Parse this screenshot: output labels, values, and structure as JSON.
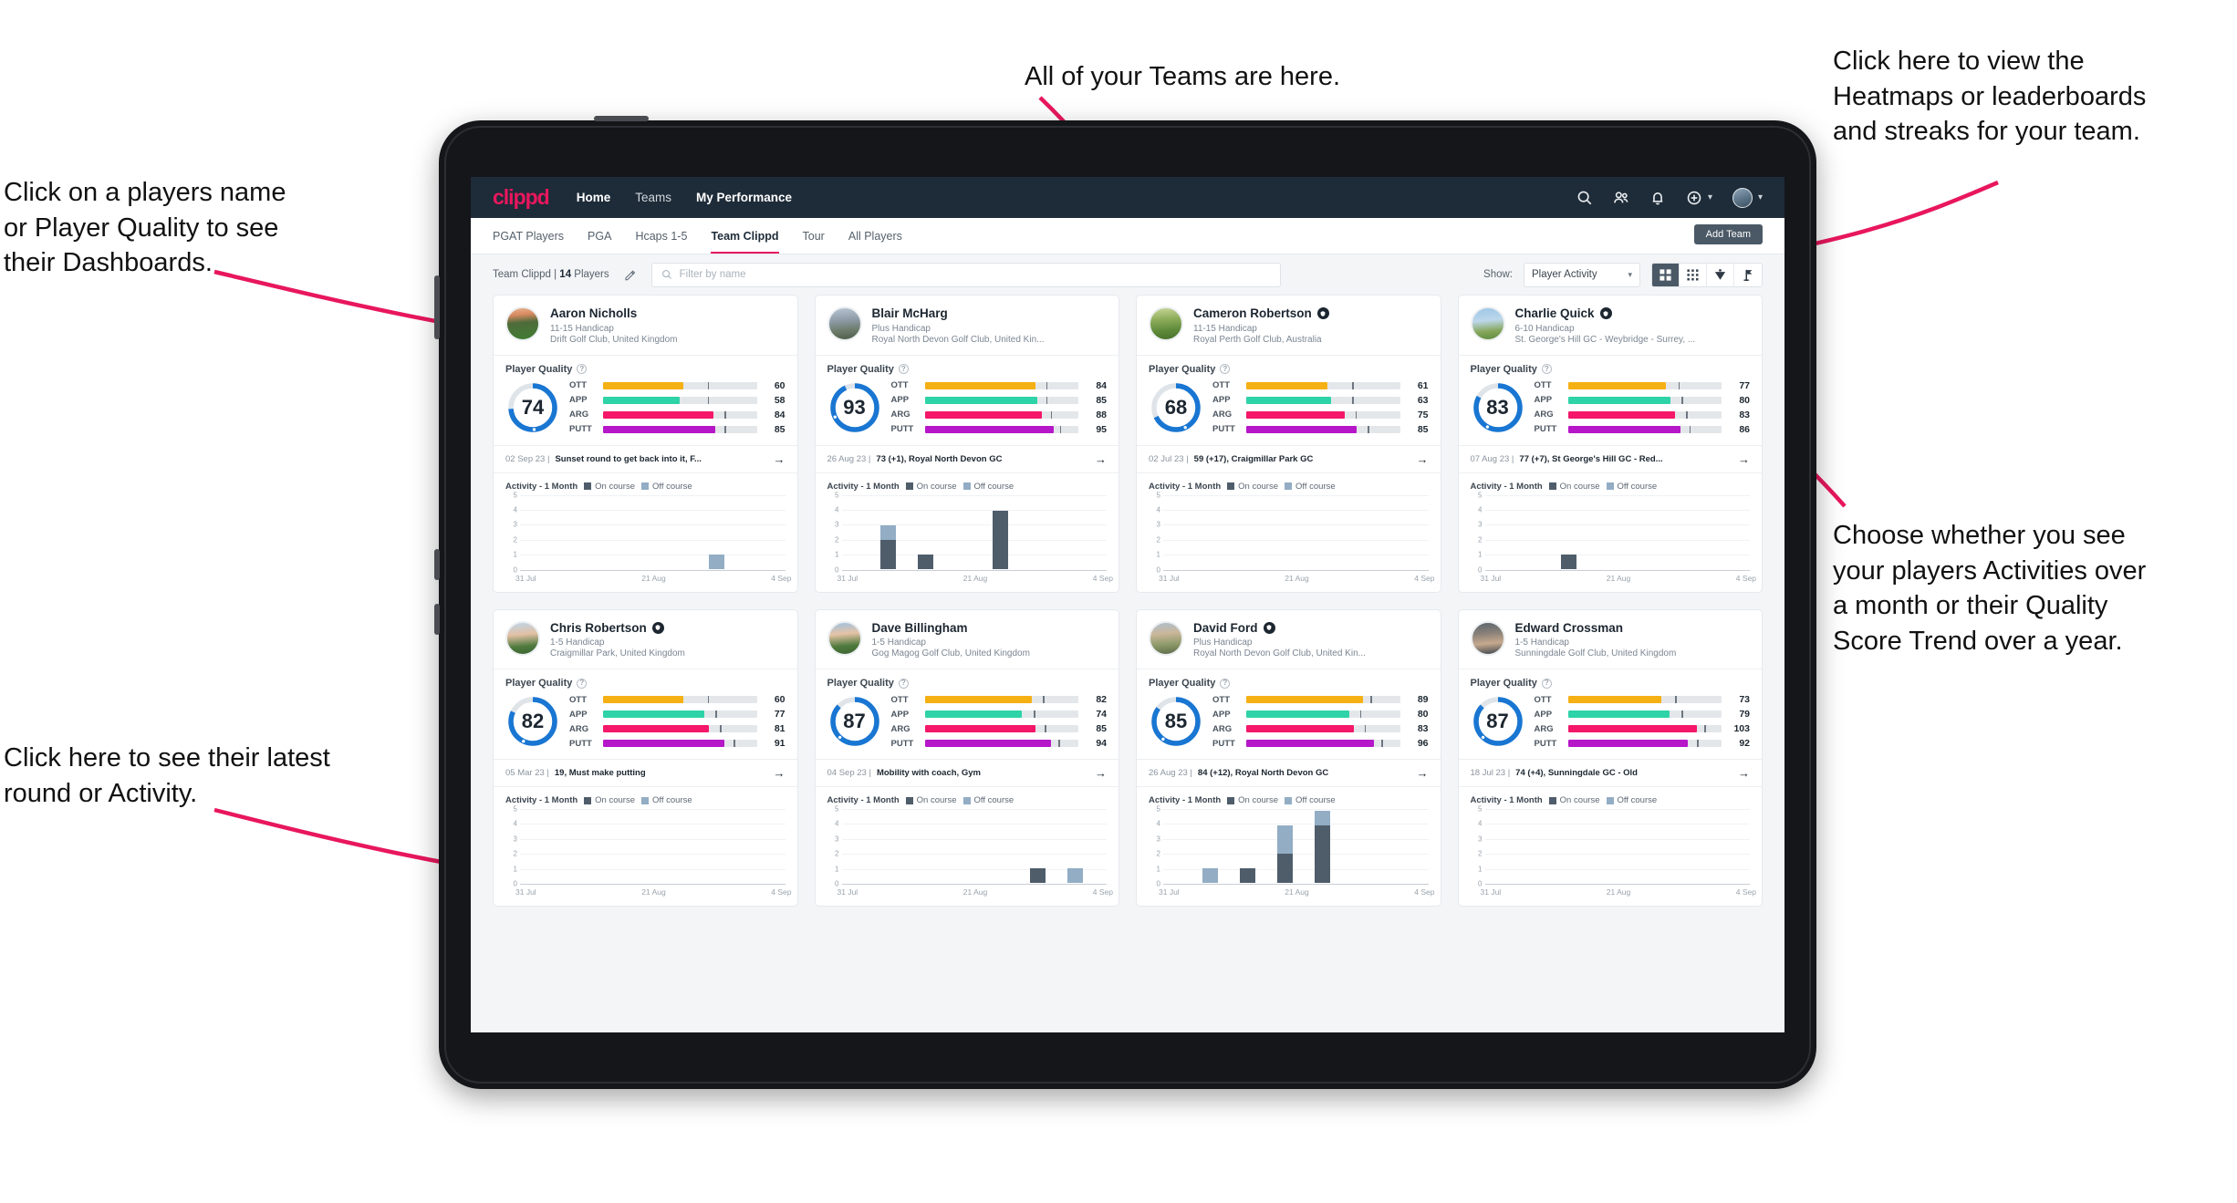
{
  "annotations": [
    {
      "id": "teams",
      "text": "All of your Teams are here."
    },
    {
      "id": "heatmaps",
      "text": "Click here to view the\nHeatmaps or leaderboards\nand streaks for your team."
    },
    {
      "id": "player-name",
      "text": "Click on a players name\nor Player Quality to see\ntheir Dashboards."
    },
    {
      "id": "activity-toggle",
      "text": "Choose whether you see\nyour players Activities over\na month or their Quality\nScore Trend over a year."
    },
    {
      "id": "latest-round",
      "text": "Click here to see their latest\nround or Activity."
    }
  ],
  "app": {
    "brand": "clippd",
    "nav": [
      {
        "label": "Home",
        "active": true
      },
      {
        "label": "Teams",
        "active": false
      },
      {
        "label": "My Performance",
        "active": false
      }
    ],
    "nav_icons": [
      "search-icon",
      "people-icon",
      "bell-icon",
      "plus-circle-icon",
      "avatar"
    ],
    "subtabs": [
      {
        "label": "PGAT Players",
        "active": false
      },
      {
        "label": "PGA",
        "active": false
      },
      {
        "label": "Hcaps 1-5",
        "active": false
      },
      {
        "label": "Team Clippd",
        "active": true
      },
      {
        "label": "Tour",
        "active": false
      },
      {
        "label": "All Players",
        "active": false
      }
    ],
    "add_team_label": "Add Team",
    "filterbar": {
      "team_prefix": "Team Clippd | ",
      "team_count": "14",
      "team_suffix": " Players",
      "edit_icon": "pencil-icon",
      "search_placeholder": "Filter by name",
      "show_label": "Show:",
      "select_value": "Player Activity",
      "view_toggles": [
        {
          "icon": "grid-large-icon",
          "active": true
        },
        {
          "icon": "grid-small-icon",
          "active": false
        },
        {
          "icon": "heatmap-icon",
          "active": false
        },
        {
          "icon": "leaderboard-flag-icon",
          "active": false
        }
      ]
    }
  },
  "labels": {
    "player_quality": "Player Quality",
    "activity": "Activity - 1 Month",
    "legend_on": "On course",
    "legend_off": "Off course",
    "skills": [
      "OTT",
      "APP",
      "ARG",
      "PUTT"
    ]
  },
  "colors": {
    "brand": "#e8175d",
    "navbar": "#1e2b38",
    "ring": "#1976d2",
    "ott": "#f5b014",
    "app": "#2ed3a7",
    "arg": "#f4176a",
    "putt": "#b517c9",
    "on_course": "#4f5d६b",
    "off_course": "#92adc4"
  },
  "chart_data": {
    "type": "bar",
    "title": "Activity - 1 Month",
    "ylabel": "",
    "ylim": [
      0,
      5
    ],
    "yticks": [
      0,
      1,
      2,
      3,
      4,
      5
    ],
    "xticks": [
      "31 Jul",
      "21 Aug",
      "4 Sep"
    ],
    "stacked": true,
    "legend": [
      "On course",
      "Off course"
    ],
    "legend_position": "top",
    "charts": [
      {
        "player": "Aaron Nicholls",
        "bins": [
          {
            "i": 5,
            "on": 0,
            "off": 1
          }
        ]
      },
      {
        "player": "Blair McHarg",
        "bins": [
          {
            "i": 1,
            "on": 2,
            "off": 1
          },
          {
            "i": 2,
            "on": 1,
            "off": 0
          },
          {
            "i": 4,
            "on": 4,
            "off": 0
          }
        ]
      },
      {
        "player": "Cameron Robertson",
        "bins": []
      },
      {
        "player": "Charlie Quick",
        "bins": [
          {
            "i": 2,
            "on": 1,
            "off": 0
          }
        ]
      },
      {
        "player": "Chris Robertson",
        "bins": []
      },
      {
        "player": "Dave Billingham",
        "bins": [
          {
            "i": 5,
            "on": 1,
            "off": 0
          },
          {
            "i": 6,
            "on": 0,
            "off": 1
          }
        ]
      },
      {
        "player": "David Ford",
        "bins": [
          {
            "i": 1,
            "on": 0,
            "off": 1
          },
          {
            "i": 2,
            "on": 1,
            "off": 0
          },
          {
            "i": 3,
            "on": 2,
            "off": 2
          },
          {
            "i": 4,
            "on": 4,
            "off": 1
          }
        ]
      },
      {
        "player": "Edward Crossman",
        "bins": []
      }
    ]
  },
  "players": [
    {
      "name": "Aaron Nicholls",
      "verified": false,
      "handicap": "11-15 Handicap",
      "club": "Drift Golf Club, United Kingdom",
      "quality": 74,
      "skills": [
        {
          "label": "OTT",
          "value": 60,
          "fill": 52,
          "mark": 68
        },
        {
          "label": "APP",
          "value": 58,
          "fill": 50,
          "mark": 68
        },
        {
          "label": "ARG",
          "value": 84,
          "fill": 72,
          "mark": 79
        },
        {
          "label": "PUTT",
          "value": 85,
          "fill": 73,
          "mark": 79
        }
      ],
      "round_date": "02 Sep 23",
      "round_text": "Sunset round to get back into it, F..."
    },
    {
      "name": "Blair McHarg",
      "verified": false,
      "handicap": "Plus Handicap",
      "club": "Royal North Devon Golf Club, United Kin...",
      "quality": 93,
      "skills": [
        {
          "label": "OTT",
          "value": 84,
          "fill": 72,
          "mark": 79
        },
        {
          "label": "APP",
          "value": 85,
          "fill": 73,
          "mark": 79
        },
        {
          "label": "ARG",
          "value": 88,
          "fill": 76,
          "mark": 82
        },
        {
          "label": "PUTT",
          "value": 95,
          "fill": 84,
          "mark": 88
        }
      ],
      "round_date": "26 Aug 23",
      "round_text": "73 (+1), Royal North Devon GC"
    },
    {
      "name": "Cameron Robertson",
      "verified": true,
      "handicap": "11-15 Handicap",
      "club": "Royal Perth Golf Club, Australia",
      "quality": 68,
      "skills": [
        {
          "label": "OTT",
          "value": 61,
          "fill": 53,
          "mark": 69
        },
        {
          "label": "APP",
          "value": 63,
          "fill": 55,
          "mark": 69
        },
        {
          "label": "ARG",
          "value": 75,
          "fill": 64,
          "mark": 71
        },
        {
          "label": "PUTT",
          "value": 85,
          "fill": 72,
          "mark": 79
        }
      ],
      "round_date": "02 Jul 23",
      "round_text": "59 (+17), Craigmillar Park GC"
    },
    {
      "name": "Charlie Quick",
      "verified": true,
      "handicap": "6-10 Handicap",
      "club": "St. George's Hill GC - Weybridge - Surrey, ...",
      "quality": 83,
      "skills": [
        {
          "label": "OTT",
          "value": 77,
          "fill": 64,
          "mark": 72
        },
        {
          "label": "APP",
          "value": 80,
          "fill": 67,
          "mark": 74
        },
        {
          "label": "ARG",
          "value": 83,
          "fill": 70,
          "mark": 77
        },
        {
          "label": "PUTT",
          "value": 86,
          "fill": 73,
          "mark": 79
        }
      ],
      "round_date": "07 Aug 23",
      "round_text": "77 (+7), St George's Hill GC - Red..."
    },
    {
      "name": "Chris Robertson",
      "verified": true,
      "handicap": "1-5 Handicap",
      "club": "Craigmillar Park, United Kingdom",
      "quality": 82,
      "skills": [
        {
          "label": "OTT",
          "value": 60,
          "fill": 52,
          "mark": 68
        },
        {
          "label": "APP",
          "value": 77,
          "fill": 66,
          "mark": 73
        },
        {
          "label": "ARG",
          "value": 81,
          "fill": 69,
          "mark": 76
        },
        {
          "label": "PUTT",
          "value": 91,
          "fill": 79,
          "mark": 85
        }
      ],
      "round_date": "05 Mar 23",
      "round_text": "19, Must make putting"
    },
    {
      "name": "Dave Billingham",
      "verified": false,
      "handicap": "1-5 Handicap",
      "club": "Gog Magog Golf Club, United Kingdom",
      "quality": 87,
      "skills": [
        {
          "label": "OTT",
          "value": 82,
          "fill": 70,
          "mark": 77
        },
        {
          "label": "APP",
          "value": 74,
          "fill": 63,
          "mark": 71
        },
        {
          "label": "ARG",
          "value": 85,
          "fill": 72,
          "mark": 78
        },
        {
          "label": "PUTT",
          "value": 94,
          "fill": 82,
          "mark": 87
        }
      ],
      "round_date": "04 Sep 23",
      "round_text": "Mobility with coach, Gym"
    },
    {
      "name": "David Ford",
      "verified": true,
      "handicap": "Plus Handicap",
      "club": "Royal North Devon Golf Club, United Kin...",
      "quality": 85,
      "skills": [
        {
          "label": "OTT",
          "value": 89,
          "fill": 76,
          "mark": 81
        },
        {
          "label": "APP",
          "value": 80,
          "fill": 67,
          "mark": 74
        },
        {
          "label": "ARG",
          "value": 83,
          "fill": 70,
          "mark": 77
        },
        {
          "label": "PUTT",
          "value": 96,
          "fill": 83,
          "mark": 88
        }
      ],
      "round_date": "26 Aug 23",
      "round_text": "84 (+12), Royal North Devon GC"
    },
    {
      "name": "Edward Crossman",
      "verified": false,
      "handicap": "1-5 Handicap",
      "club": "Sunningdale Golf Club, United Kingdom",
      "quality": 87,
      "skills": [
        {
          "label": "OTT",
          "value": 73,
          "fill": 61,
          "mark": 70
        },
        {
          "label": "APP",
          "value": 79,
          "fill": 66,
          "mark": 74
        },
        {
          "label": "ARG",
          "value": 103,
          "fill": 84,
          "mark": 89
        },
        {
          "label": "PUTT",
          "value": 92,
          "fill": 78,
          "mark": 84
        }
      ],
      "round_date": "18 Jul 23",
      "round_text": "74 (+4), Sunningdale GC - Old"
    }
  ]
}
